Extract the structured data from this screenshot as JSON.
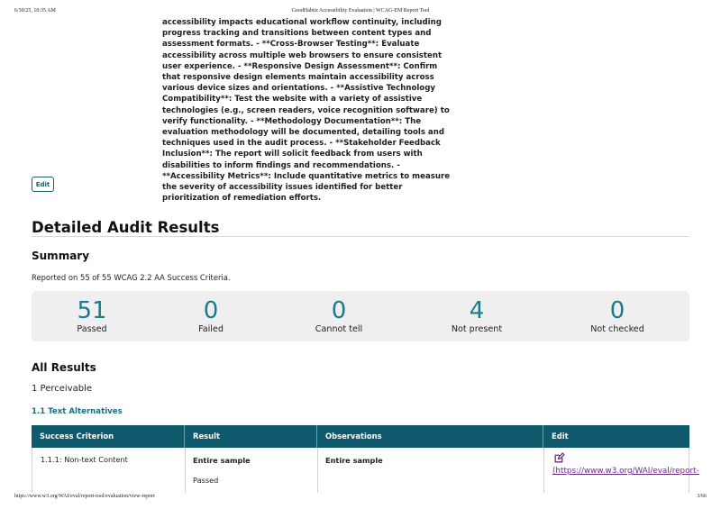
{
  "print_header": {
    "datetime": "6/30/25, 10:35 AM",
    "page_title": "GoodHabitz Accessibility Evaluation | WCAG-EM Report Tool"
  },
  "print_footer": {
    "url": "https://www.w3.org/WAI/eval/report-tool/evaluation/view-report",
    "page": "3/66"
  },
  "scope_description": "accessibility impacts educational workflow continuity, including progress tracking and transitions between content types and assessment formats. - **Cross-Browser Testing**: Evaluate accessibility across multiple web browsers to ensure consistent user experience. - **Responsive Design Assessment**: Confirm that responsive design elements maintain accessibility across various device sizes and orientations. - **Assistive Technology Compatibility**: Test the website with a variety of assistive technologies (e.g., screen readers, voice recognition software) to verify functionality. - **Methodology Documentation**: The evaluation methodology will be documented, detailing tools and techniques used in the audit process. - **Stakeholder Feedback Inclusion**: The report will solicit feedback from users with disabilities to inform findings and recommendations. - **Accessibility Metrics**: Include quantitative metrics to measure the severity of accessibility issues identified for better prioritization of remediation efforts.",
  "edit_button_label": "Edit",
  "detailed_heading": "Detailed Audit Results",
  "summary": {
    "heading": "Summary",
    "reported_text": "Reported on 55 of 55 WCAG 2.2 AA Success Criteria.",
    "stats": [
      {
        "value": "51",
        "label": "Passed"
      },
      {
        "value": "0",
        "label": "Failed"
      },
      {
        "value": "0",
        "label": "Cannot tell"
      },
      {
        "value": "4",
        "label": "Not present"
      },
      {
        "value": "0",
        "label": "Not checked"
      }
    ]
  },
  "all_results": {
    "heading": "All Results",
    "principle": "1 Perceivable",
    "guideline": "1.1 Text Alternatives",
    "columns": [
      "Success Criterion",
      "Result",
      "Observations",
      "Edit"
    ],
    "rows": [
      {
        "criterion": "1.1.1: Non-text Content",
        "result_scope": "Entire sample",
        "result_value": "Passed",
        "observations_scope": "Entire sample",
        "edit_link_text": "(https://www.w3.org/WAI/eval/report-"
      }
    ]
  },
  "colors": {
    "accent_teal": "#1b7a8c",
    "table_header_bg": "#0e5a6c",
    "link_purple": "#6b2a84",
    "stats_bg": "#efefef"
  },
  "icons": {
    "edit": "edit-pencil-square-icon"
  }
}
